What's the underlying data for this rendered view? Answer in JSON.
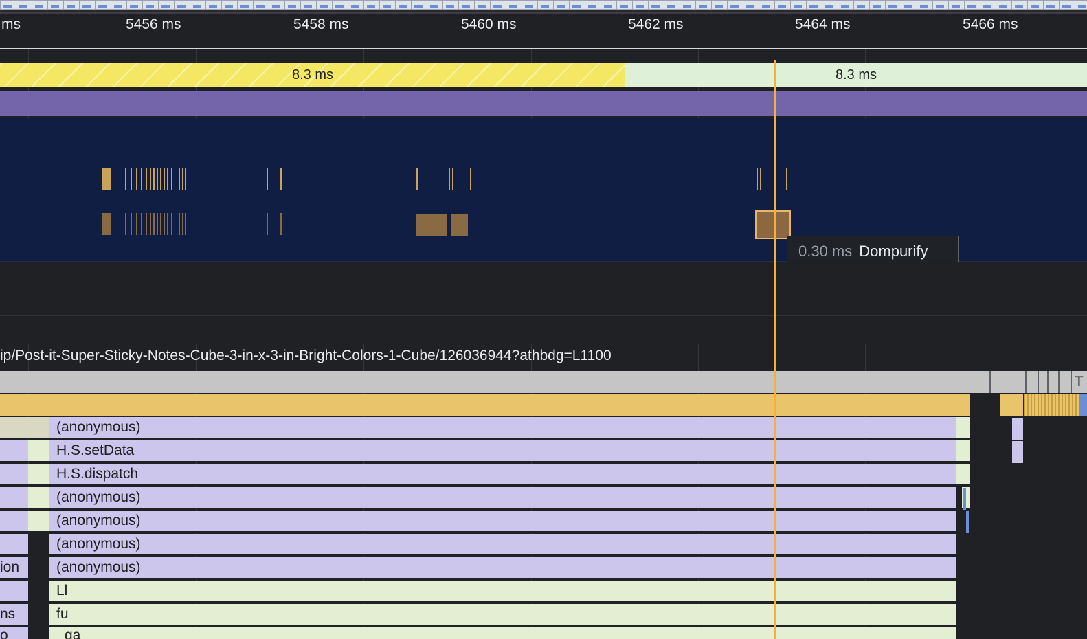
{
  "ruler": {
    "ticks": [
      "ms",
      "5456 ms",
      "5458 ms",
      "5460 ms",
      "5462 ms",
      "5464 ms",
      "5466 ms"
    ]
  },
  "frames": {
    "dropped_label": "8.3 ms",
    "ok_label": "8.3 ms"
  },
  "tooltip": {
    "duration": "0.30 ms",
    "name": "Dompurify"
  },
  "main_thread": {
    "url": "ip/Post-it-Super-Sticky-Notes-Cube-3-in-x-3-in-Bright-Colors-1-Cube/126036944?athbdg=L1100",
    "edge_label": "T",
    "calls": [
      "(anonymous)",
      "H.S.setData",
      "H.S.dispatch",
      "(anonymous)",
      "(anonymous)",
      "(anonymous)",
      "(anonymous)",
      "Ll",
      "fu",
      "ga"
    ],
    "left_fragments": [
      "ion",
      "ns",
      "o"
    ]
  },
  "colors": {
    "frame_dropped": "#f4e764",
    "frame_ok": "#dff0d8",
    "interaction": "#7465aa",
    "gpu_bg": "#0f1e42",
    "call_lavender": "#cdc6ec",
    "call_lime": "#e4eed3",
    "playhead": "#f3b03b"
  }
}
